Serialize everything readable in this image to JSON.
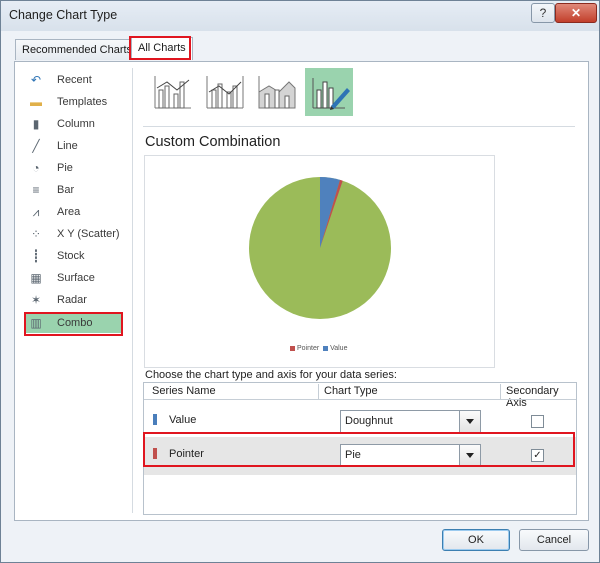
{
  "window": {
    "title": "Change Chart Type",
    "help": "?",
    "close": "✕"
  },
  "tabs": [
    {
      "label": "Recommended Charts"
    },
    {
      "label": "All Charts"
    }
  ],
  "sidebar": {
    "items": [
      {
        "label": "Recent",
        "icon": "recent-icon",
        "glyph": "↶"
      },
      {
        "label": "Templates",
        "icon": "folder-icon",
        "glyph": "▬"
      },
      {
        "label": "Column",
        "icon": "column-chart-icon",
        "glyph": "▮"
      },
      {
        "label": "Line",
        "icon": "line-chart-icon",
        "glyph": "╱"
      },
      {
        "label": "Pie",
        "icon": "pie-chart-icon",
        "glyph": "◔"
      },
      {
        "label": "Bar",
        "icon": "bar-chart-icon",
        "glyph": "≡"
      },
      {
        "label": "Area",
        "icon": "area-chart-icon",
        "glyph": "⩘"
      },
      {
        "label": "X Y (Scatter)",
        "icon": "scatter-chart-icon",
        "glyph": "⁘"
      },
      {
        "label": "Stock",
        "icon": "stock-chart-icon",
        "glyph": "┋"
      },
      {
        "label": "Surface",
        "icon": "surface-chart-icon",
        "glyph": "▦"
      },
      {
        "label": "Radar",
        "icon": "radar-chart-icon",
        "glyph": "✶"
      },
      {
        "label": "Combo",
        "icon": "combo-chart-icon",
        "glyph": "▥"
      }
    ]
  },
  "main": {
    "heading": "Custom Combination",
    "legend": {
      "pointer": "Pointer",
      "value": "Value"
    },
    "choose_label": "Choose the chart type and axis for your data series:",
    "columns": {
      "name": "Series Name",
      "type": "Chart Type",
      "axis": "Secondary Axis"
    },
    "series": [
      {
        "name": "Value",
        "type": "Doughnut",
        "secondary_axis": false,
        "color": "#4a7ebb"
      },
      {
        "name": "Pointer",
        "type": "Pie",
        "secondary_axis": true,
        "color": "#c0504d"
      }
    ],
    "check_glyph": "✓"
  },
  "colors": {
    "pie_main": "#9bbb59",
    "pie_value": "#4f81bd",
    "pie_pointer": "#c0504d",
    "highlight": "#e0151f",
    "selected": "#9ad3ae"
  },
  "buttons": {
    "ok": "OK",
    "cancel": "Cancel"
  }
}
